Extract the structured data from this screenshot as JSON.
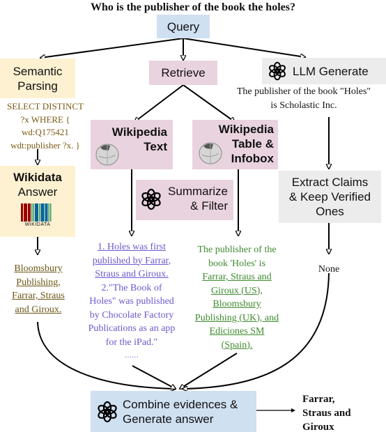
{
  "title": "Who is the publisher of the book the holes?",
  "nodes": {
    "query": "Query",
    "semantic_parsing": [
      "Semantic",
      "Parsing"
    ],
    "sparql": [
      "SELECT DISTINCT",
      "?x WHERE {",
      "wd:Q175421",
      "wdt:publisher ?x. }"
    ],
    "wikidata_answer": {
      "title": "Wikidata",
      "subtitle": "Answer",
      "logo_label": "WIKIDATA"
    },
    "wikidata_result": [
      "Bloomsbury",
      "Publishing,",
      "Farrar, Straus",
      "and Giroux."
    ],
    "retrieve": "Retrieve",
    "wikipedia_text": [
      "Wikipedia",
      "Text"
    ],
    "wikipedia_table": [
      "Wikipedia",
      "Table &",
      "Infobox"
    ],
    "summarize": [
      "Summarize",
      "& Filter"
    ],
    "wiki_text_result": {
      "underlined": [
        "1. Holes was first",
        "published by Farrar,",
        "Straus and Giroux."
      ],
      "plain": [
        "2.\"The Book of",
        "Holes\" was published",
        "by Chocolate Factory",
        "Publications as an app",
        "for the iPad.\""
      ],
      "ellipsis": "……"
    },
    "wiki_table_result": {
      "plain": [
        "The publisher of the",
        "book 'Holes' is"
      ],
      "underlined": [
        "Farrar, Straus and",
        "Giroux (US),",
        "Bloomsbury",
        "Publishing (UK), and",
        "Ediciones SM",
        "(Spain)."
      ]
    },
    "llm_generate": "LLM Generate",
    "llm_output": [
      "The publisher of the book \"Holes\"",
      "is Scholastic Inc."
    ],
    "extract_claims": [
      "Extract Claims",
      "& Keep Verified",
      "Ones"
    ],
    "claims_result": "None",
    "combine": [
      "Combine evidences &",
      "Generate answer"
    ],
    "final_answer": [
      "Farrar,",
      "Straus and",
      "Giroux"
    ]
  },
  "colors": {
    "query_box": "#cfe0f1",
    "semantic_box": "#fdf1d1",
    "retrieve_box": "#e9d3de",
    "llm_box": "#ececec",
    "sparql_text": "#7a5a14",
    "wikidata_result_text": "#6b5514",
    "wiki_text_result": "#6a5acd",
    "wiki_table_result": "#3e8a2e"
  }
}
